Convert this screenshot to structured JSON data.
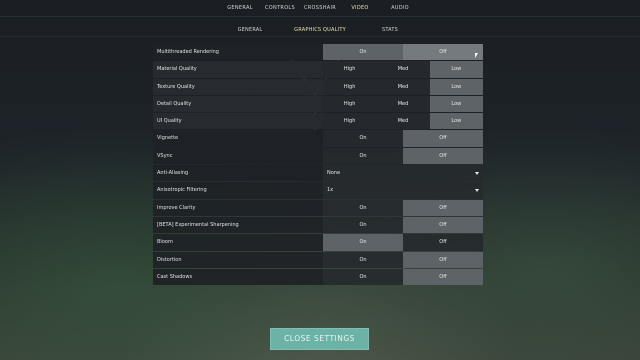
{
  "nav": {
    "tabs": [
      {
        "label": "GENERAL"
      },
      {
        "label": "CONTROLS"
      },
      {
        "label": "CROSSHAIR"
      },
      {
        "label": "VIDEO",
        "active": true
      },
      {
        "label": "AUDIO"
      }
    ]
  },
  "subnav": {
    "tabs": [
      {
        "label": "GENERAL"
      },
      {
        "label": "GRAPHICS QUALITY",
        "active": true
      },
      {
        "label": "STATS"
      }
    ]
  },
  "settings": [
    {
      "label": "Multithreaded Rendering",
      "type": "toggle",
      "options": [
        "On",
        "Off"
      ],
      "selected": "On"
    },
    {
      "label": "Material Quality",
      "type": "quality",
      "options": [
        "High",
        "Med",
        "Low"
      ],
      "selected": "Low"
    },
    {
      "label": "Texture Quality",
      "type": "quality",
      "options": [
        "High",
        "Med",
        "Low"
      ],
      "selected": "Low"
    },
    {
      "label": "Detail Quality",
      "type": "quality",
      "options": [
        "High",
        "Med",
        "Low"
      ],
      "selected": "Low"
    },
    {
      "label": "UI Quality",
      "type": "quality",
      "options": [
        "High",
        "Med",
        "Low"
      ],
      "selected": "Low"
    },
    {
      "label": "Vignette",
      "type": "toggle",
      "options": [
        "On",
        "Off"
      ],
      "selected": "Off"
    },
    {
      "label": "VSync",
      "type": "toggle",
      "options": [
        "On",
        "Off"
      ],
      "selected": "Off"
    },
    {
      "label": "Anti-Aliasing",
      "type": "select",
      "value": "None"
    },
    {
      "label": "Anisotropic Filtering",
      "type": "select",
      "value": "1x"
    },
    {
      "label": "Improve Clarity",
      "type": "toggle",
      "options": [
        "On",
        "Off"
      ],
      "selected": "Off"
    },
    {
      "label": "[BETA] Experimental Sharpening",
      "type": "toggle",
      "options": [
        "On",
        "Off"
      ],
      "selected": "Off"
    },
    {
      "label": "Bloom",
      "type": "toggle",
      "options": [
        "On",
        "Off"
      ],
      "selected": "On"
    },
    {
      "label": "Distortion",
      "type": "toggle",
      "options": [
        "On",
        "Off"
      ],
      "selected": "Off"
    },
    {
      "label": "Cast Shadows",
      "type": "toggle",
      "options": [
        "On",
        "Off"
      ],
      "selected": "Off"
    }
  ],
  "footer": {
    "close_label": "CLOSE SETTINGS"
  },
  "colors": {
    "accent": "#e9e2a6",
    "button": "#6bb3a7"
  },
  "icons": {
    "cursor": "mouse-pointer-icon",
    "dropdown": "chevron-down-icon"
  }
}
